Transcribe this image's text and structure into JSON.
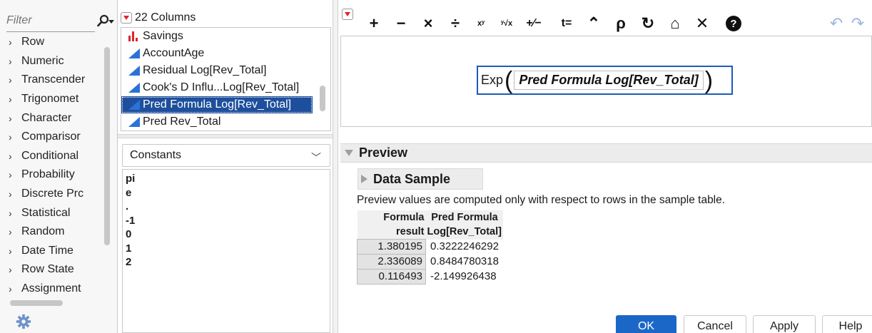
{
  "functions_panel": {
    "filter_placeholder": "Filter",
    "categories": [
      "Row",
      "Numeric",
      "Transcender",
      "Trigonomet",
      "Character",
      "Comparisor",
      "Conditional",
      "Probability",
      "Discrete Prc",
      "Statistical",
      "Random",
      "Date Time",
      "Row State",
      "Assignment"
    ]
  },
  "columns_panel": {
    "title": "22 Columns",
    "items": [
      {
        "label": "Savings",
        "type": "bar-chart-icon"
      },
      {
        "label": "AccountAge",
        "type": "continuous-icon"
      },
      {
        "label": "Residual Log[Rev_Total]",
        "type": "continuous-icon"
      },
      {
        "label": "Cook's D Influ...Log[Rev_Total]",
        "type": "continuous-icon"
      },
      {
        "label": "Pred Formula Log[Rev_Total]",
        "type": "continuous-icon",
        "selected": true
      },
      {
        "label": "Pred Rev_Total",
        "type": "continuous-icon"
      }
    ]
  },
  "constants_panel": {
    "selected": "Constants",
    "items": [
      "pi",
      "e",
      ".",
      "-1",
      "0",
      "1",
      "2"
    ]
  },
  "toolbar": {
    "buttons": [
      {
        "name": "add-icon",
        "glyph": "+"
      },
      {
        "name": "subtract-icon",
        "glyph": "−"
      },
      {
        "name": "multiply-icon",
        "glyph": "×"
      },
      {
        "name": "divide-icon",
        "glyph": "÷"
      },
      {
        "name": "power-icon",
        "glyph": "xʸ"
      },
      {
        "name": "root-icon",
        "glyph": "ʸ√x"
      },
      {
        "name": "negate-icon",
        "glyph": "+⁄−"
      },
      {
        "name": "local-variable-icon",
        "glyph": "t="
      },
      {
        "name": "raise-icon",
        "glyph": "⌃"
      },
      {
        "name": "peel-icon",
        "glyph": "ρ"
      },
      {
        "name": "swap-icon",
        "glyph": "↻"
      },
      {
        "name": "unthrow-icon",
        "glyph": "⌂"
      },
      {
        "name": "delete-icon",
        "glyph": "✕"
      },
      {
        "name": "help-icon",
        "glyph": "?"
      },
      {
        "name": "undo-icon",
        "glyph": "↶"
      },
      {
        "name": "redo-icon",
        "glyph": "↷"
      }
    ]
  },
  "formula": {
    "function": "Exp",
    "argument": "Pred Formula Log[Rev_Total]"
  },
  "preview": {
    "title": "Preview",
    "sample_title": "Data Sample",
    "note": "Preview values are computed only with respect to rows in the sample table.",
    "table": {
      "headers": [
        [
          "Formula",
          "result"
        ],
        [
          "Pred Formula",
          "Log[Rev_Total]"
        ]
      ],
      "rows": [
        [
          "1.380195",
          "0.3222246292"
        ],
        [
          "2.336089",
          "0.8484780318"
        ],
        [
          "0.116493",
          "-2.149926438"
        ]
      ]
    }
  },
  "dialog_buttons": {
    "ok": "OK",
    "cancel": "Cancel",
    "apply": "Apply",
    "help": "Help"
  },
  "colors": {
    "accent": "#1e4f9c",
    "ok_button": "#1a67c7",
    "formula_border": "#1e5bb6",
    "dropdown_red": "#e0242a"
  }
}
